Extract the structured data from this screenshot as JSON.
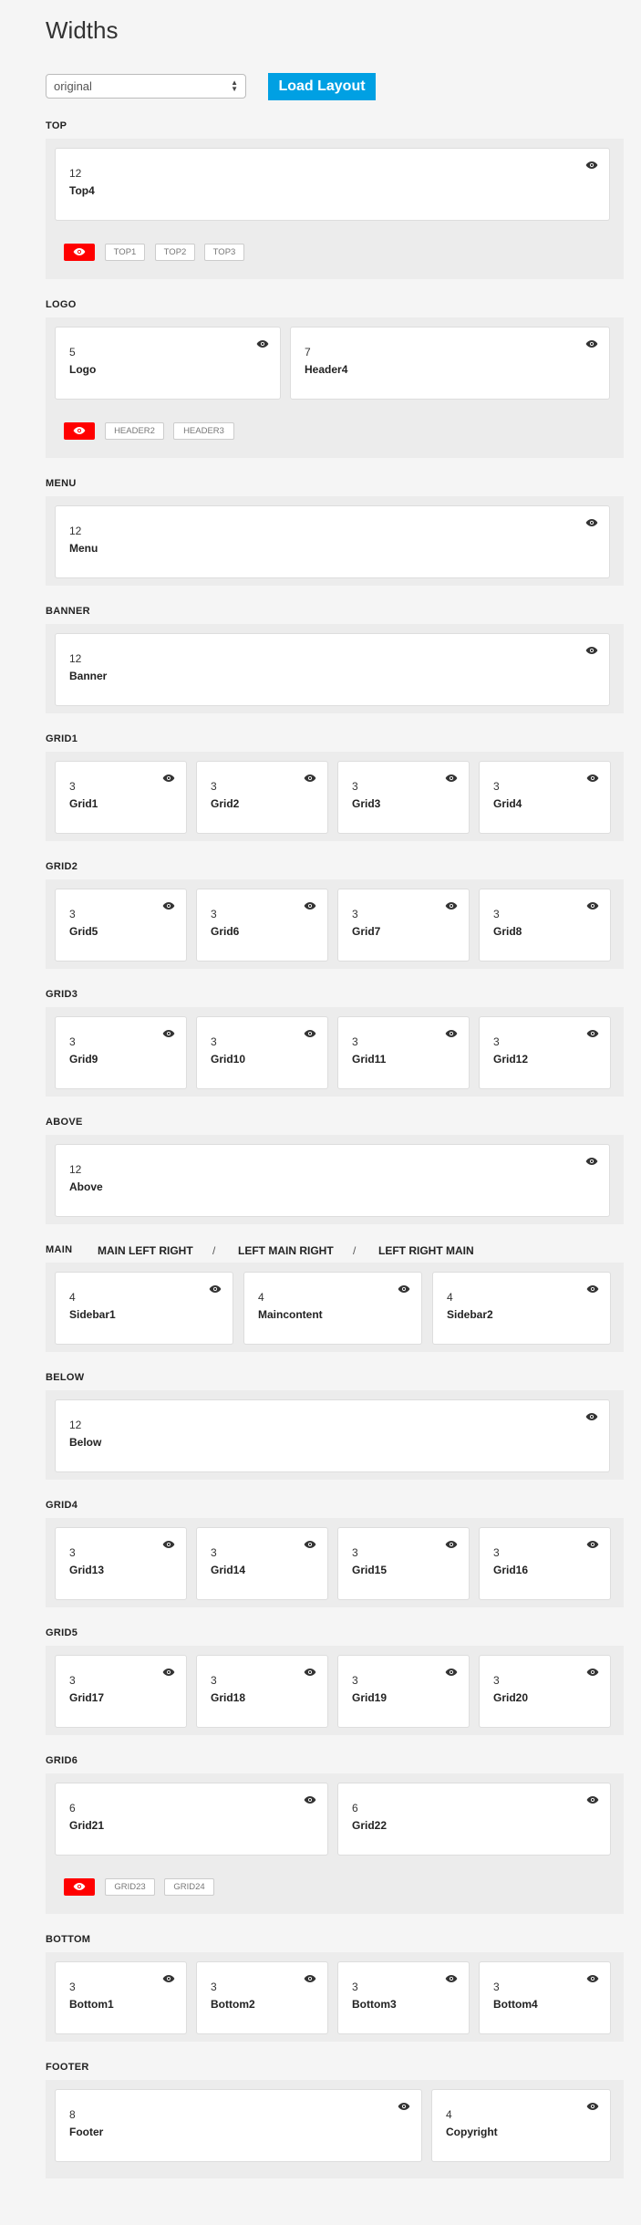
{
  "page_title": "Widths",
  "layout_select": {
    "value": "original"
  },
  "load_button": "Load Layout",
  "icons": {
    "visible": "eye-icon"
  },
  "colors": {
    "accent": "#00a0e3",
    "hidden_toggle": "#ff0000",
    "panel": "#ececec"
  },
  "sections": {
    "top": {
      "label": "TOP",
      "cards": [
        {
          "width": "12",
          "name": "Top4"
        }
      ],
      "hidden": [
        "TOP1",
        "TOP2",
        "TOP3"
      ]
    },
    "logo": {
      "label": "LOGO",
      "cards": [
        {
          "width": "5",
          "name": "Logo"
        },
        {
          "width": "7",
          "name": "Header4"
        }
      ],
      "hidden": [
        "HEADER2",
        "HEADER3"
      ]
    },
    "menu": {
      "label": "MENU",
      "cards": [
        {
          "width": "12",
          "name": "Menu"
        }
      ]
    },
    "banner": {
      "label": "BANNER",
      "cards": [
        {
          "width": "12",
          "name": "Banner"
        }
      ]
    },
    "grid1": {
      "label": "GRID1",
      "cards": [
        {
          "width": "3",
          "name": "Grid1"
        },
        {
          "width": "3",
          "name": "Grid2"
        },
        {
          "width": "3",
          "name": "Grid3"
        },
        {
          "width": "3",
          "name": "Grid4"
        }
      ]
    },
    "grid2": {
      "label": "GRID2",
      "cards": [
        {
          "width": "3",
          "name": "Grid5"
        },
        {
          "width": "3",
          "name": "Grid6"
        },
        {
          "width": "3",
          "name": "Grid7"
        },
        {
          "width": "3",
          "name": "Grid8"
        }
      ]
    },
    "grid3": {
      "label": "GRID3",
      "cards": [
        {
          "width": "3",
          "name": "Grid9"
        },
        {
          "width": "3",
          "name": "Grid10"
        },
        {
          "width": "3",
          "name": "Grid11"
        },
        {
          "width": "3",
          "name": "Grid12"
        }
      ]
    },
    "above": {
      "label": "ABOVE",
      "cards": [
        {
          "width": "12",
          "name": "Above"
        }
      ]
    },
    "main": {
      "label": "MAIN",
      "options": [
        "MAIN LEFT RIGHT",
        "LEFT MAIN RIGHT",
        "LEFT RIGHT MAIN"
      ],
      "separator": "/",
      "cards": [
        {
          "width": "4",
          "name": "Sidebar1"
        },
        {
          "width": "4",
          "name": "Maincontent"
        },
        {
          "width": "4",
          "name": "Sidebar2"
        }
      ]
    },
    "below": {
      "label": "BELOW",
      "cards": [
        {
          "width": "12",
          "name": "Below"
        }
      ]
    },
    "grid4": {
      "label": "GRID4",
      "cards": [
        {
          "width": "3",
          "name": "Grid13"
        },
        {
          "width": "3",
          "name": "Grid14"
        },
        {
          "width": "3",
          "name": "Grid15"
        },
        {
          "width": "3",
          "name": "Grid16"
        }
      ]
    },
    "grid5": {
      "label": "GRID5",
      "cards": [
        {
          "width": "3",
          "name": "Grid17"
        },
        {
          "width": "3",
          "name": "Grid18"
        },
        {
          "width": "3",
          "name": "Grid19"
        },
        {
          "width": "3",
          "name": "Grid20"
        }
      ]
    },
    "grid6": {
      "label": "GRID6",
      "cards": [
        {
          "width": "6",
          "name": "Grid21"
        },
        {
          "width": "6",
          "name": "Grid22"
        }
      ],
      "hidden": [
        "GRID23",
        "GRID24"
      ]
    },
    "bottom": {
      "label": "BOTTOM",
      "cards": [
        {
          "width": "3",
          "name": "Bottom1"
        },
        {
          "width": "3",
          "name": "Bottom2"
        },
        {
          "width": "3",
          "name": "Bottom3"
        },
        {
          "width": "3",
          "name": "Bottom4"
        }
      ]
    },
    "footer": {
      "label": "FOOTER",
      "cards": [
        {
          "width": "8",
          "name": "Footer"
        },
        {
          "width": "4",
          "name": "Copyright"
        }
      ]
    }
  }
}
